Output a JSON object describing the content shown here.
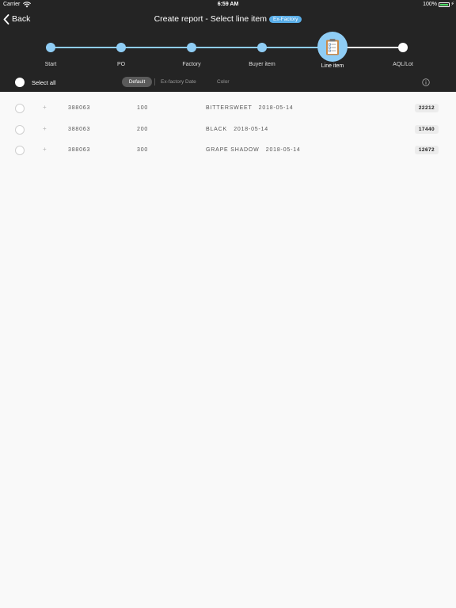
{
  "status_bar": {
    "carrier": "Carrier",
    "time": "6:59 AM",
    "battery": "100%",
    "battery_level": 1.0
  },
  "nav": {
    "back_label": "Back",
    "title": "Create report - Select line item",
    "badge": "Ex-Factory"
  },
  "steps": [
    {
      "label": "Start",
      "state": "done"
    },
    {
      "label": "PO",
      "state": "done"
    },
    {
      "label": "Factory",
      "state": "done"
    },
    {
      "label": "Buyer item",
      "state": "done"
    },
    {
      "label": "Line item",
      "state": "active",
      "icon": "clipboard-checklist-icon"
    },
    {
      "label": "AQL/Lot",
      "state": "pending"
    }
  ],
  "filter_bar": {
    "select_all_label": "Select all",
    "segments": [
      "Default",
      "Ex-factory Date",
      "Color"
    ],
    "selected_segment": "Default"
  },
  "rows": [
    {
      "po": "388063",
      "line": "100",
      "description": "BITTERSWEET   2018-05-14",
      "quantity": "22212"
    },
    {
      "po": "388063",
      "line": "200",
      "description": "BLACK   2018-05-14",
      "quantity": "17440"
    },
    {
      "po": "388063",
      "line": "300",
      "description": "GRAPE SHADOW   2018-05-14",
      "quantity": "12672"
    }
  ],
  "colors": {
    "header_bg": "#242424",
    "accent_blue": "#8fcdf5",
    "badge_blue": "#5aaee8",
    "page_bg": "#f9f9f9"
  }
}
